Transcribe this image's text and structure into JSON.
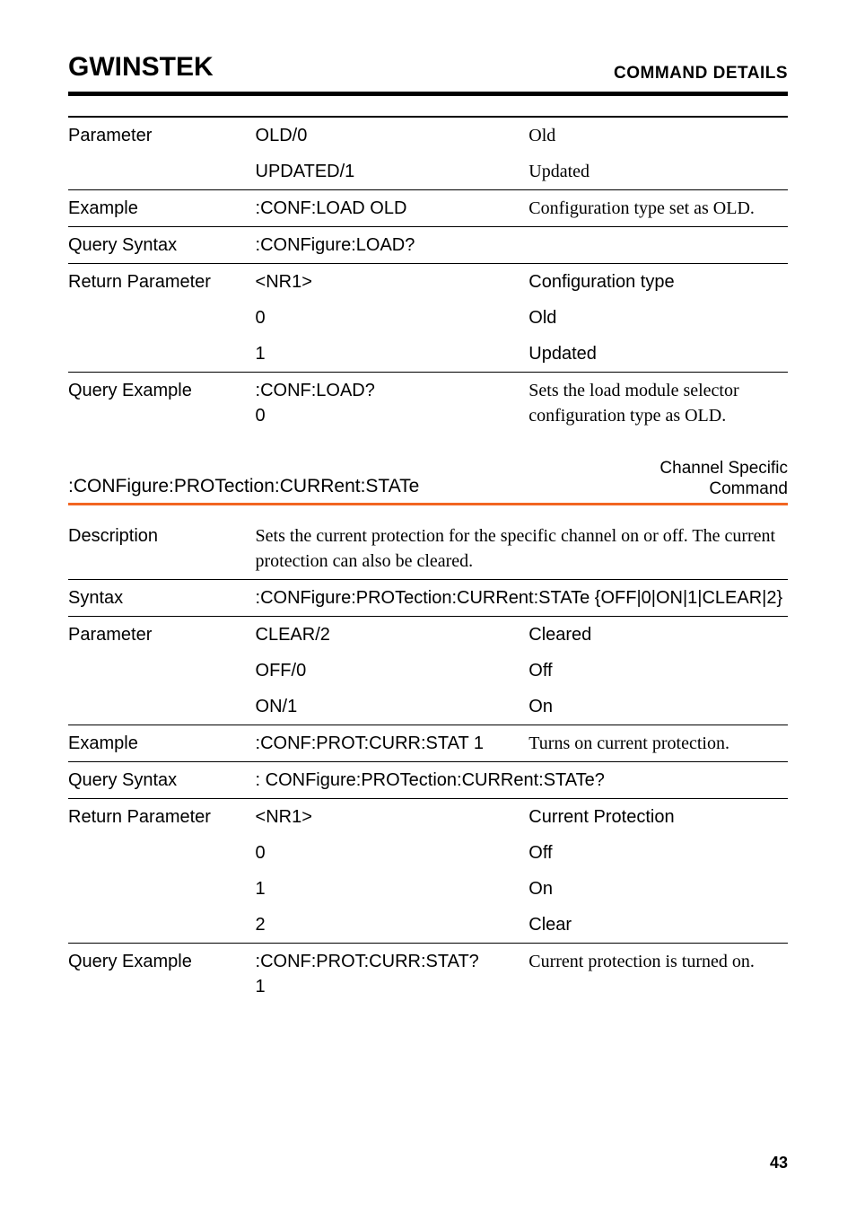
{
  "header": {
    "logo": "GWINSTEK",
    "title": "COMMAND DETAILS"
  },
  "table1": {
    "rows": [
      {
        "label": "Parameter",
        "mid": "OLD/0",
        "right": "Old",
        "top": "first"
      },
      {
        "label": "",
        "mid": "UPDATED/1",
        "right": "Updated"
      },
      {
        "label": "Example",
        "mid": ":CONF:LOAD OLD",
        "right": "Configuration type set as OLD.",
        "top": "thin"
      },
      {
        "label": "Query Syntax",
        "mid": ":CONFigure:LOAD?",
        "right": "",
        "top": "thin",
        "span": true
      },
      {
        "label": "Return Parameter",
        "mid": "<NR1>",
        "right": "Configuration type",
        "top": "thin",
        "rightSans": true
      },
      {
        "label": "",
        "mid": "0",
        "right": "Old",
        "rightSans": true
      },
      {
        "label": "",
        "mid": "1",
        "right": "Updated",
        "rightSans": true
      },
      {
        "label": "Query Example",
        "mid": ":CONF:LOAD?\n0",
        "right": "Sets the load module selector configuration type as OLD.",
        "top": "thin"
      }
    ]
  },
  "section": {
    "name": ":CONFigure:PROTection:CURRent:STATe",
    "type_line1": "Channel Specific",
    "type_line2": "Command"
  },
  "table2": {
    "rows": [
      {
        "label": "Description",
        "desc": "Sets the current protection for the specific channel on or off. The current protection can also be cleared."
      },
      {
        "label": "Syntax",
        "mid": ":CONFigure:PROTection:CURRent:STATe {OFF|0|ON|1|CLEAR|2}",
        "top": "thin",
        "span": true
      },
      {
        "label": "Parameter",
        "mid": "CLEAR/2",
        "right": "Cleared",
        "top": "thin",
        "rightSans": true
      },
      {
        "label": "",
        "mid": "OFF/0",
        "right": "Off",
        "rightSans": true
      },
      {
        "label": "",
        "mid": "ON/1",
        "right": "On",
        "rightSans": true
      },
      {
        "label": "Example",
        "mid": ":CONF:PROT:CURR:STAT 1",
        "right": "Turns on current protection.",
        "top": "thin"
      },
      {
        "label": "Query Syntax",
        "mid": ": CONFigure:PROTection:CURRent:STATe?",
        "top": "thin",
        "span": true
      },
      {
        "label": "Return Parameter",
        "mid": "<NR1>",
        "right": "Current Protection",
        "top": "thin",
        "rightSans": true
      },
      {
        "label": "",
        "mid": "0",
        "right": "Off",
        "rightSans": true
      },
      {
        "label": "",
        "mid": "1",
        "right": "On",
        "rightSans": true
      },
      {
        "label": "",
        "mid": "2",
        "right": "Clear",
        "rightSans": true
      },
      {
        "label": "Query Example",
        "mid": ":CONF:PROT:CURR:STAT?\n1",
        "right": "Current protection is turned on.",
        "top": "thin"
      }
    ]
  },
  "page": "43"
}
